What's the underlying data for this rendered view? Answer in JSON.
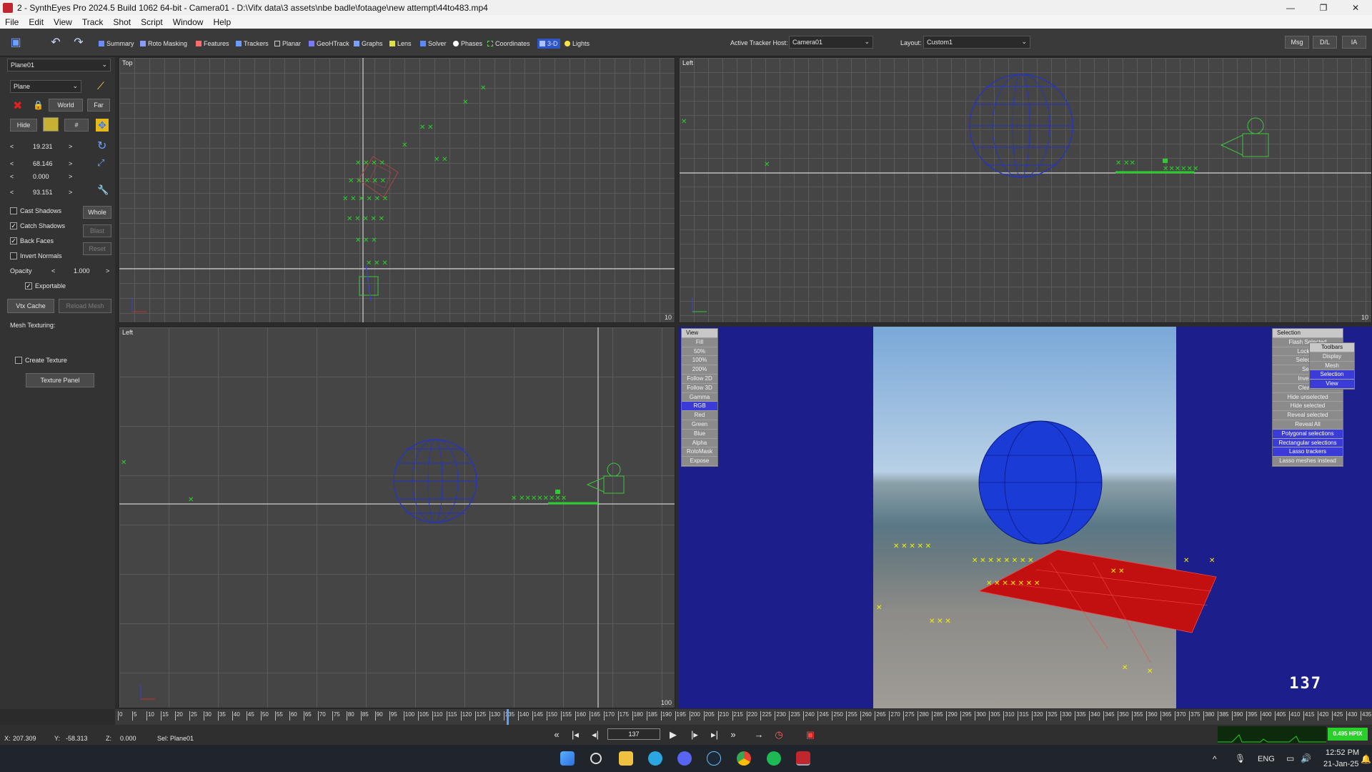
{
  "window": {
    "title": "2 - SynthEyes Pro 2024.5 Build 1062 64-bit - Camera01 - D:\\Vifx data\\3 assets\\nbe badle\\fotaage\\new attempt\\44to483.mp4",
    "minimize": "—",
    "maximize": "❐",
    "close": "✕"
  },
  "menu": [
    "File",
    "Edit",
    "View",
    "Track",
    "Shot",
    "Script",
    "Window",
    "Help"
  ],
  "toolbar": {
    "rooms": [
      "Summary",
      "Roto Masking",
      "Features",
      "Trackers",
      "Planar",
      "GeoHTrack",
      "Graphs",
      "Lens",
      "Solver",
      "Phases",
      "Coordinates",
      "3-D",
      "Lights"
    ],
    "active_tracker_host_label": "Active Tracker Host:",
    "active_tracker_host_value": "Camera01",
    "layout_label": "Layout:",
    "layout_value": "Custom1",
    "right_buttons": [
      "Msg",
      "D/L",
      "IA"
    ]
  },
  "panel": {
    "object_select": "Plane01",
    "type_select": "Plane",
    "world_btn": "World",
    "far_btn": "Far",
    "hide_btn": "Hide",
    "hash_btn": "#",
    "values": [
      "19.231",
      "68.146",
      "0.000",
      "93.151"
    ],
    "cast_shadows": "Cast Shadows",
    "whole_btn": "Whole",
    "catch_shadows": "Catch Shadows",
    "blast_btn": "Blast",
    "back_faces": "Back Faces",
    "reset_btn": "Reset",
    "invert_normals": "Invert Normals",
    "opacity_label": "Opacity",
    "opacity_value": "1.000",
    "exportable": "Exportable",
    "vtx_cache_btn": "Vtx Cache",
    "reload_mesh_btn": "Reload Mesh",
    "mesh_texturing": "Mesh Texturing:",
    "create_texture": "Create Texture",
    "texture_panel_btn": "Texture Panel"
  },
  "viewports": {
    "top_left": {
      "name": "Top",
      "num": "10"
    },
    "top_right": {
      "name": "Left",
      "num": "10"
    },
    "bottom_left": {
      "name": "Left",
      "num": "100"
    }
  },
  "camera_view": {
    "view_menu": [
      "View",
      "Fill",
      "50%",
      "100%",
      "200%",
      "Follow 2D",
      "Follow 3D",
      "Gamma",
      "RGB",
      "Red",
      "Green",
      "Blue",
      "Alpha",
      "RotoMask",
      "Expose"
    ],
    "selection_menu": [
      "Selection",
      "Flash Selected",
      "Lock Se",
      "Select sa",
      "Sele",
      "Invert S",
      "Clear S",
      "Hide unselected",
      "Hide selected",
      "Reveal selected",
      "Reveal All",
      "Polygonal selections",
      "Rectangular selections",
      "Lasso trackers",
      "Lasso meshes instead"
    ],
    "submenu": [
      "Toolbars",
      "Display",
      "Mesh",
      "Selection",
      "View"
    ],
    "frame": "137"
  },
  "timeline": {
    "ticks": [
      "0",
      "5",
      "10",
      "15",
      "20",
      "25",
      "30",
      "35",
      "40",
      "45",
      "50",
      "55",
      "60",
      "65",
      "70",
      "75",
      "80",
      "85",
      "90",
      "95",
      "100",
      "105",
      "110",
      "115",
      "120",
      "125",
      "130",
      "135",
      "140",
      "145",
      "150",
      "155",
      "160",
      "165",
      "170",
      "175",
      "180",
      "185",
      "190",
      "195",
      "200",
      "205",
      "210",
      "215",
      "220",
      "225",
      "230",
      "235",
      "240",
      "245",
      "250",
      "255",
      "260",
      "265",
      "270",
      "275",
      "280",
      "285",
      "290",
      "295",
      "300",
      "305",
      "310",
      "315",
      "320",
      "325",
      "330",
      "335",
      "340",
      "345",
      "350",
      "355",
      "360",
      "365",
      "370",
      "375",
      "380",
      "385",
      "390",
      "395",
      "400",
      "405",
      "410",
      "415",
      "420",
      "425",
      "430",
      "435"
    ],
    "current_frame": "137",
    "hpix": "0.495 HPIX"
  },
  "status": {
    "x_label": "X:",
    "x": "207.309",
    "y_label": "Y:",
    "y": "-58.313",
    "z_label": "Z:",
    "z": "0.000",
    "sel": "Sel: Plane01"
  },
  "taskbar": {
    "lang": "ENG",
    "time": "12:52 PM",
    "date": "21-Jan-25"
  },
  "colors": {
    "tracker_green": "#20d020",
    "mesh_blue": "#1e3bd0",
    "plane_red": "#c01010",
    "camera_bg": "#1c1e8c",
    "tracker_yellow": "#f0f000"
  }
}
